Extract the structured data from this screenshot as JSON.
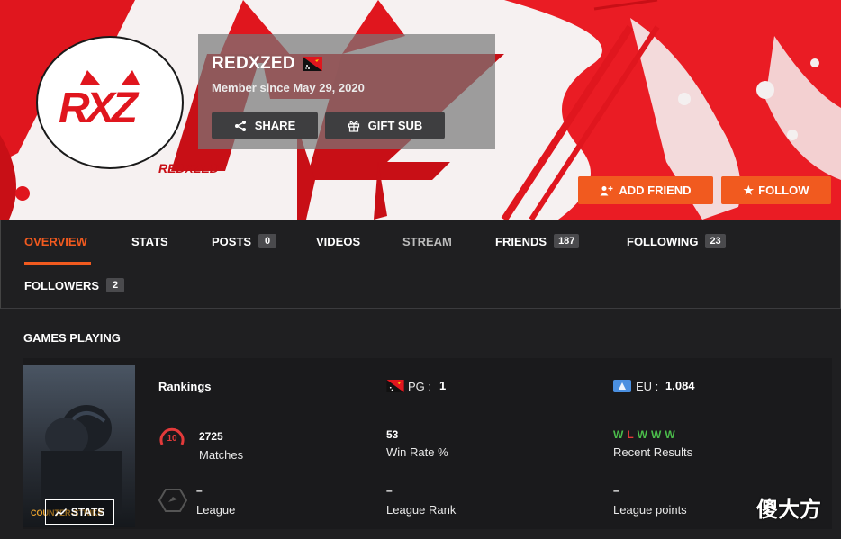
{
  "profile": {
    "username": "REDXZED",
    "member_since": "Member since May 29, 2020",
    "avatar_text": "RXZ",
    "banner_text": "REDXZED",
    "flag_icon": "papua-new-guinea-flag-icon"
  },
  "actions": {
    "share_label": "SHARE",
    "gift_label": "GIFT SUB",
    "add_friend_label": "ADD FRIEND",
    "follow_label": "FOLLOW"
  },
  "tabs": [
    {
      "label": "OVERVIEW",
      "active": true
    },
    {
      "label": "STATS"
    },
    {
      "label": "POSTS",
      "count": "0"
    },
    {
      "label": "VIDEOS"
    },
    {
      "label": "STREAM"
    },
    {
      "label": "FRIENDS",
      "count": "187"
    },
    {
      "label": "FOLLOWING",
      "count": "23"
    },
    {
      "label": "FOLLOWERS",
      "count": "2"
    }
  ],
  "games": {
    "title": "GAMES PLAYING",
    "cover_title": "COUNTER-STRIKE",
    "stats_button": "STATS",
    "rankings_label": "Rankings",
    "pg_rank_label": "PG :",
    "pg_rank_value": "1",
    "eu_rank_label": "EU :",
    "eu_rank_value": "1,084",
    "level": "10",
    "matches_value": "2725",
    "matches_label": "Matches",
    "win_rate_value": "53",
    "win_rate_label": "Win Rate %",
    "recent_results": [
      "W",
      "L",
      "W",
      "W",
      "W"
    ],
    "recent_results_label": "Recent Results",
    "league_value": "–",
    "league_label": "League",
    "league_rank_value": "–",
    "league_rank_label": "League Rank",
    "league_points_value": "–",
    "league_points_label": "League points"
  },
  "colors": {
    "accent": "#f15a1f",
    "win": "#4bbd4b",
    "loss": "#e33a3a",
    "background": "#1f1f21"
  },
  "watermark": "傻大方"
}
